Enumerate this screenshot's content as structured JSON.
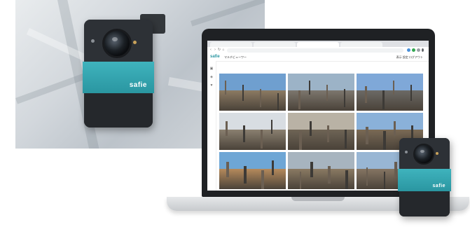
{
  "camera": {
    "brand": "safie",
    "body_color": "#2a2d31",
    "band_color": "#2fa3ae"
  },
  "browser": {
    "tabs": [
      "",
      "",
      "",
      ""
    ],
    "icons": [
      "back-icon",
      "forward-icon",
      "reload-icon",
      "home-icon"
    ]
  },
  "app": {
    "logo": "safie",
    "title": "マルチビューワー",
    "right_text": "表示 設定 ログアウト",
    "sidebar_icons": [
      "camera-icon",
      "map-icon",
      "filter-icon"
    ],
    "tiles": [
      {
        "scene": "site-overview",
        "sky": "#6f9fcf",
        "ground": "#8c7b63"
      },
      {
        "scene": "scaffolding",
        "sky": "#9cb3c7",
        "ground": "#7d776e"
      },
      {
        "scene": "roof-frame",
        "sky": "#7fa8d8",
        "ground": "#6c6a66"
      },
      {
        "scene": "crane-site",
        "sky": "#d8dde2",
        "ground": "#8a8070"
      },
      {
        "scene": "workers",
        "sky": "#b9b2a5",
        "ground": "#6e6455"
      },
      {
        "scene": "city-construction",
        "sky": "#8ab1d9",
        "ground": "#7a6a55"
      },
      {
        "scene": "excavation",
        "sky": "#6ea6d5",
        "ground": "#b58a5c"
      },
      {
        "scene": "rebar-workers",
        "sky": "#a7b4bf",
        "ground": "#8a7a63"
      },
      {
        "scene": "steel-frame",
        "sky": "#98b6d4",
        "ground": "#857563"
      }
    ]
  }
}
